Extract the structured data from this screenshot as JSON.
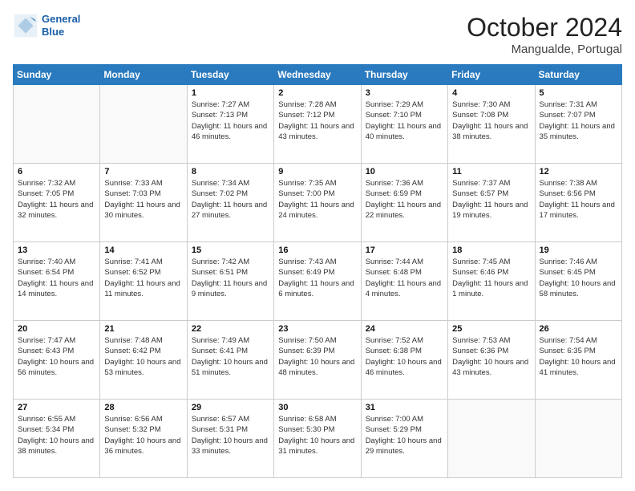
{
  "logo": {
    "line1": "General",
    "line2": "Blue"
  },
  "title": "October 2024",
  "location": "Mangualde, Portugal",
  "days_header": [
    "Sunday",
    "Monday",
    "Tuesday",
    "Wednesday",
    "Thursday",
    "Friday",
    "Saturday"
  ],
  "weeks": [
    [
      {
        "day": "",
        "sunrise": "",
        "sunset": "",
        "daylight": ""
      },
      {
        "day": "",
        "sunrise": "",
        "sunset": "",
        "daylight": ""
      },
      {
        "day": "1",
        "sunrise": "Sunrise: 7:27 AM",
        "sunset": "Sunset: 7:13 PM",
        "daylight": "Daylight: 11 hours and 46 minutes."
      },
      {
        "day": "2",
        "sunrise": "Sunrise: 7:28 AM",
        "sunset": "Sunset: 7:12 PM",
        "daylight": "Daylight: 11 hours and 43 minutes."
      },
      {
        "day": "3",
        "sunrise": "Sunrise: 7:29 AM",
        "sunset": "Sunset: 7:10 PM",
        "daylight": "Daylight: 11 hours and 40 minutes."
      },
      {
        "day": "4",
        "sunrise": "Sunrise: 7:30 AM",
        "sunset": "Sunset: 7:08 PM",
        "daylight": "Daylight: 11 hours and 38 minutes."
      },
      {
        "day": "5",
        "sunrise": "Sunrise: 7:31 AM",
        "sunset": "Sunset: 7:07 PM",
        "daylight": "Daylight: 11 hours and 35 minutes."
      }
    ],
    [
      {
        "day": "6",
        "sunrise": "Sunrise: 7:32 AM",
        "sunset": "Sunset: 7:05 PM",
        "daylight": "Daylight: 11 hours and 32 minutes."
      },
      {
        "day": "7",
        "sunrise": "Sunrise: 7:33 AM",
        "sunset": "Sunset: 7:03 PM",
        "daylight": "Daylight: 11 hours and 30 minutes."
      },
      {
        "day": "8",
        "sunrise": "Sunrise: 7:34 AM",
        "sunset": "Sunset: 7:02 PM",
        "daylight": "Daylight: 11 hours and 27 minutes."
      },
      {
        "day": "9",
        "sunrise": "Sunrise: 7:35 AM",
        "sunset": "Sunset: 7:00 PM",
        "daylight": "Daylight: 11 hours and 24 minutes."
      },
      {
        "day": "10",
        "sunrise": "Sunrise: 7:36 AM",
        "sunset": "Sunset: 6:59 PM",
        "daylight": "Daylight: 11 hours and 22 minutes."
      },
      {
        "day": "11",
        "sunrise": "Sunrise: 7:37 AM",
        "sunset": "Sunset: 6:57 PM",
        "daylight": "Daylight: 11 hours and 19 minutes."
      },
      {
        "day": "12",
        "sunrise": "Sunrise: 7:38 AM",
        "sunset": "Sunset: 6:56 PM",
        "daylight": "Daylight: 11 hours and 17 minutes."
      }
    ],
    [
      {
        "day": "13",
        "sunrise": "Sunrise: 7:40 AM",
        "sunset": "Sunset: 6:54 PM",
        "daylight": "Daylight: 11 hours and 14 minutes."
      },
      {
        "day": "14",
        "sunrise": "Sunrise: 7:41 AM",
        "sunset": "Sunset: 6:52 PM",
        "daylight": "Daylight: 11 hours and 11 minutes."
      },
      {
        "day": "15",
        "sunrise": "Sunrise: 7:42 AM",
        "sunset": "Sunset: 6:51 PM",
        "daylight": "Daylight: 11 hours and 9 minutes."
      },
      {
        "day": "16",
        "sunrise": "Sunrise: 7:43 AM",
        "sunset": "Sunset: 6:49 PM",
        "daylight": "Daylight: 11 hours and 6 minutes."
      },
      {
        "day": "17",
        "sunrise": "Sunrise: 7:44 AM",
        "sunset": "Sunset: 6:48 PM",
        "daylight": "Daylight: 11 hours and 4 minutes."
      },
      {
        "day": "18",
        "sunrise": "Sunrise: 7:45 AM",
        "sunset": "Sunset: 6:46 PM",
        "daylight": "Daylight: 11 hours and 1 minute."
      },
      {
        "day": "19",
        "sunrise": "Sunrise: 7:46 AM",
        "sunset": "Sunset: 6:45 PM",
        "daylight": "Daylight: 10 hours and 58 minutes."
      }
    ],
    [
      {
        "day": "20",
        "sunrise": "Sunrise: 7:47 AM",
        "sunset": "Sunset: 6:43 PM",
        "daylight": "Daylight: 10 hours and 56 minutes."
      },
      {
        "day": "21",
        "sunrise": "Sunrise: 7:48 AM",
        "sunset": "Sunset: 6:42 PM",
        "daylight": "Daylight: 10 hours and 53 minutes."
      },
      {
        "day": "22",
        "sunrise": "Sunrise: 7:49 AM",
        "sunset": "Sunset: 6:41 PM",
        "daylight": "Daylight: 10 hours and 51 minutes."
      },
      {
        "day": "23",
        "sunrise": "Sunrise: 7:50 AM",
        "sunset": "Sunset: 6:39 PM",
        "daylight": "Daylight: 10 hours and 48 minutes."
      },
      {
        "day": "24",
        "sunrise": "Sunrise: 7:52 AM",
        "sunset": "Sunset: 6:38 PM",
        "daylight": "Daylight: 10 hours and 46 minutes."
      },
      {
        "day": "25",
        "sunrise": "Sunrise: 7:53 AM",
        "sunset": "Sunset: 6:36 PM",
        "daylight": "Daylight: 10 hours and 43 minutes."
      },
      {
        "day": "26",
        "sunrise": "Sunrise: 7:54 AM",
        "sunset": "Sunset: 6:35 PM",
        "daylight": "Daylight: 10 hours and 41 minutes."
      }
    ],
    [
      {
        "day": "27",
        "sunrise": "Sunrise: 6:55 AM",
        "sunset": "Sunset: 5:34 PM",
        "daylight": "Daylight: 10 hours and 38 minutes."
      },
      {
        "day": "28",
        "sunrise": "Sunrise: 6:56 AM",
        "sunset": "Sunset: 5:32 PM",
        "daylight": "Daylight: 10 hours and 36 minutes."
      },
      {
        "day": "29",
        "sunrise": "Sunrise: 6:57 AM",
        "sunset": "Sunset: 5:31 PM",
        "daylight": "Daylight: 10 hours and 33 minutes."
      },
      {
        "day": "30",
        "sunrise": "Sunrise: 6:58 AM",
        "sunset": "Sunset: 5:30 PM",
        "daylight": "Daylight: 10 hours and 31 minutes."
      },
      {
        "day": "31",
        "sunrise": "Sunrise: 7:00 AM",
        "sunset": "Sunset: 5:29 PM",
        "daylight": "Daylight: 10 hours and 29 minutes."
      },
      {
        "day": "",
        "sunrise": "",
        "sunset": "",
        "daylight": ""
      },
      {
        "day": "",
        "sunrise": "",
        "sunset": "",
        "daylight": ""
      }
    ]
  ]
}
